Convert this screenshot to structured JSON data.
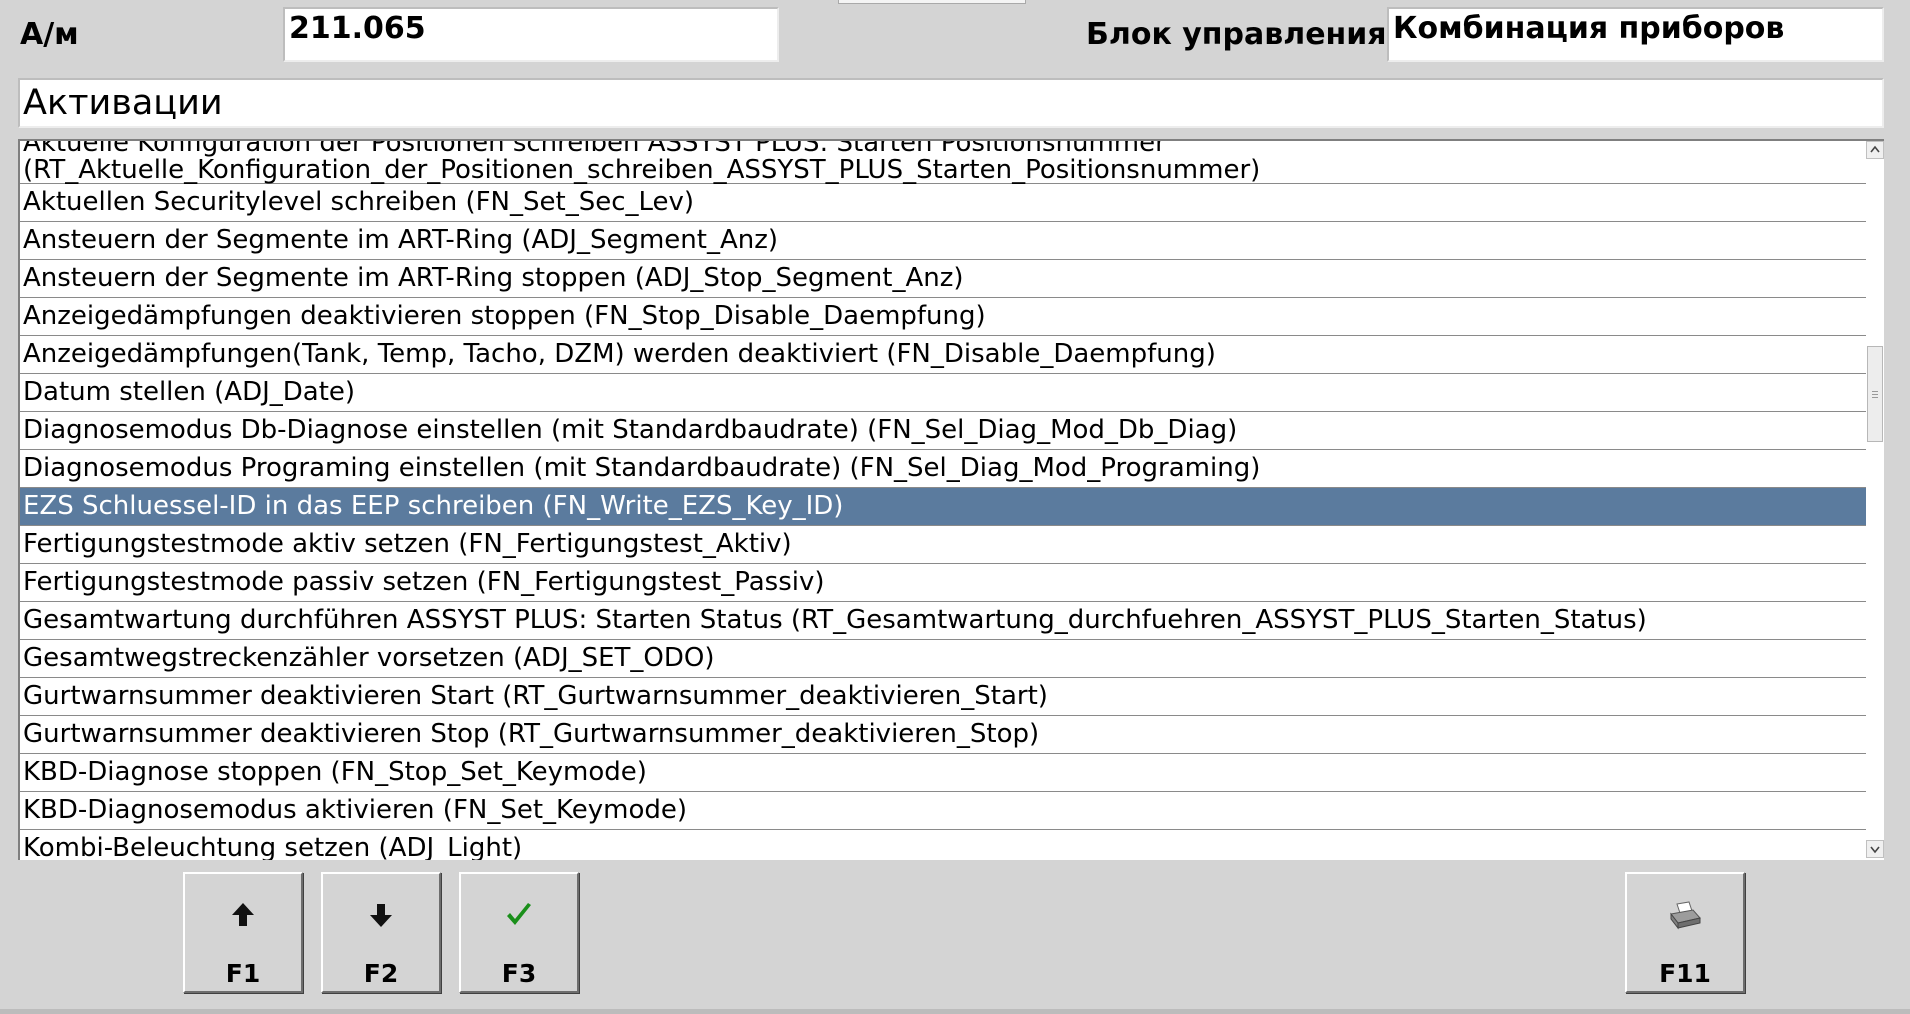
{
  "header": {
    "vehicle_label": "А/м",
    "vehicle_value": "211.065",
    "ecu_label": "Блок управления",
    "ecu_value": "Комбинация приборов"
  },
  "section_title": "Активации",
  "list": {
    "first_cut_line": "Aktuelle Konfiguration der Positionen schreiben ASSYST PLUS: Starten Positionsnummer",
    "first_line2": "(RT_Aktuelle_Konfiguration_der_Positionen_schreiben_ASSYST_PLUS_Starten_Positionsnummer)",
    "items": [
      "Aktuellen Securitylevel schreiben (FN_Set_Sec_Lev)",
      "Ansteuern der Segmente im ART-Ring (ADJ_Segment_Anz)",
      "Ansteuern der Segmente im ART-Ring stoppen (ADJ_Stop_Segment_Anz)",
      "Anzeigedämpfungen deaktivieren stoppen (FN_Stop_Disable_Daempfung)",
      "Anzeigedämpfungen(Tank, Temp, Tacho, DZM) werden deaktiviert (FN_Disable_Daempfung)",
      "Datum stellen (ADJ_Date)",
      "Diagnosemodus Db-Diagnose einstellen (mit Standardbaudrate) (FN_Sel_Diag_Mod_Db_Diag)",
      "Diagnosemodus Programing einstellen (mit Standardbaudrate) (FN_Sel_Diag_Mod_Programing)",
      "EZS Schluessel-ID in das EEP schreiben (FN_Write_EZS_Key_ID)",
      "Fertigungstestmode aktiv setzen (FN_Fertigungstest_Aktiv)",
      "Fertigungstestmode passiv setzen (FN_Fertigungstest_Passiv)",
      "Gesamtwartung durchführen ASSYST PLUS: Starten Status (RT_Gesamtwartung_durchfuehren_ASSYST_PLUS_Starten_Status)",
      "Gesamtwegstreckenzähler vorsetzen (ADJ_SET_ODO)",
      "Gurtwarnsummer deaktivieren Start (RT_Gurtwarnsummer_deaktivieren_Start)",
      "Gurtwarnsummer deaktivieren Stop (RT_Gurtwarnsummer_deaktivieren_Stop)",
      "KBD-Diagnose stoppen (FN_Stop_Set_Keymode)",
      "KBD-Diagnosemodus aktivieren (FN_Set_Keymode)"
    ],
    "last_cut_line": "Kombi-Beleuchtung setzen (ADJ_Light)",
    "selected_item": "EZS Schluessel-ID in das EEP schreiben (FN_Write_EZS_Key_ID)",
    "selected_color": "#5b7b9e"
  },
  "scrollbar": {
    "up_icon": "scroll-up-arrow-icon",
    "down_icon": "scroll-down-arrow-icon"
  },
  "function_keys": [
    {
      "label": "F1",
      "icon": "arrow-up-icon"
    },
    {
      "label": "F2",
      "icon": "arrow-down-icon"
    },
    {
      "label": "F3",
      "icon": "checkmark-icon",
      "icon_color": "#1a8f1a"
    },
    {
      "label": "F11",
      "icon": "printer-icon"
    }
  ]
}
